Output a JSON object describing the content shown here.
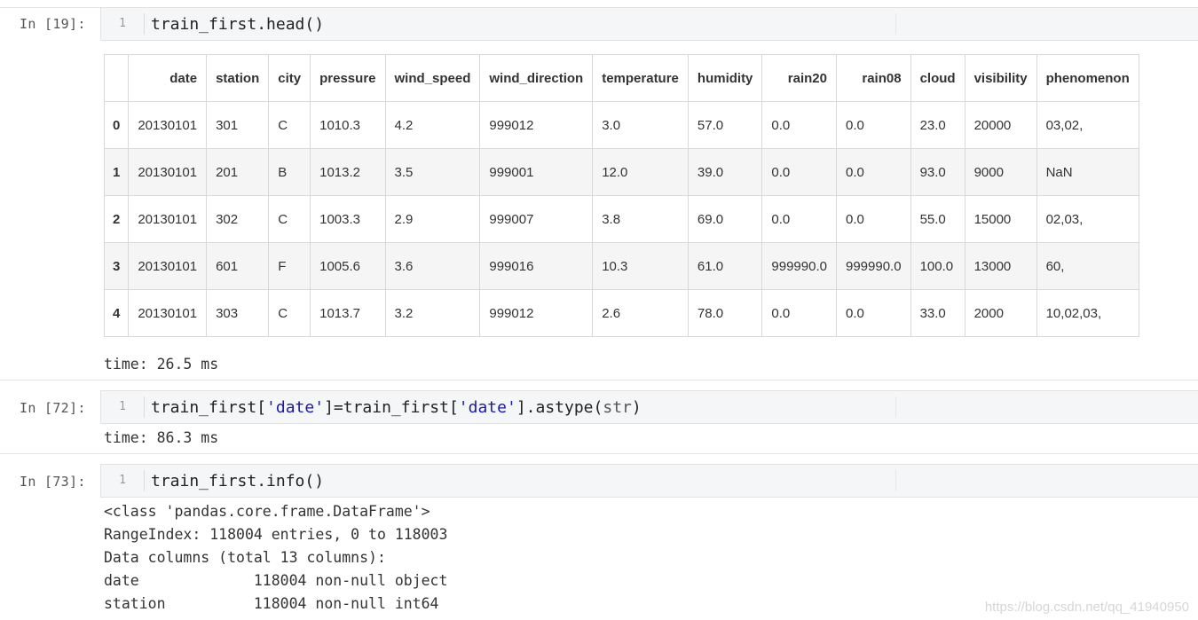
{
  "cells": [
    {
      "prompt": "In [19]:",
      "line_number": "1",
      "code": "train_first.head()",
      "time": "time: 26.5 ms"
    },
    {
      "prompt": "In [72]:",
      "line_number": "1",
      "code_parts": [
        "train_first[",
        "'date'",
        "]=train_first[",
        "'date'",
        "].astype(",
        "str",
        ")"
      ],
      "time": "time: 86.3 ms"
    },
    {
      "prompt": "In [73]:",
      "line_number": "1",
      "code": "train_first.info()",
      "output_lines": [
        "<class 'pandas.core.frame.DataFrame'>",
        "RangeIndex: 118004 entries, 0 to 118003",
        "Data columns (total 13 columns):",
        "date             118004 non-null object",
        "station          118004 non-null int64"
      ]
    }
  ],
  "dataframe": {
    "columns": [
      "",
      "date",
      "station",
      "city",
      "pressure",
      "wind_speed",
      "wind_direction",
      "temperature",
      "humidity",
      "rain20",
      "rain08",
      "cloud",
      "visibility",
      "phenomenon"
    ],
    "rows": [
      [
        "0",
        "20130101",
        "301",
        "C",
        "1010.3",
        "4.2",
        "999012",
        "3.0",
        "57.0",
        "0.0",
        "0.0",
        "23.0",
        "20000",
        "03,02,"
      ],
      [
        "1",
        "20130101",
        "201",
        "B",
        "1013.2",
        "3.5",
        "999001",
        "12.0",
        "39.0",
        "0.0",
        "0.0",
        "93.0",
        "9000",
        "NaN"
      ],
      [
        "2",
        "20130101",
        "302",
        "C",
        "1003.3",
        "2.9",
        "999007",
        "3.8",
        "69.0",
        "0.0",
        "0.0",
        "55.0",
        "15000",
        "02,03,"
      ],
      [
        "3",
        "20130101",
        "601",
        "F",
        "1005.6",
        "3.6",
        "999016",
        "10.3",
        "61.0",
        "999990.0",
        "999990.0",
        "100.0",
        "13000",
        "60,"
      ],
      [
        "4",
        "20130101",
        "303",
        "C",
        "1013.7",
        "3.2",
        "999012",
        "2.6",
        "78.0",
        "0.0",
        "0.0",
        "33.0",
        "2000",
        "10,02,03,"
      ]
    ]
  },
  "watermark": "https://blog.csdn.net/qq_41940950"
}
